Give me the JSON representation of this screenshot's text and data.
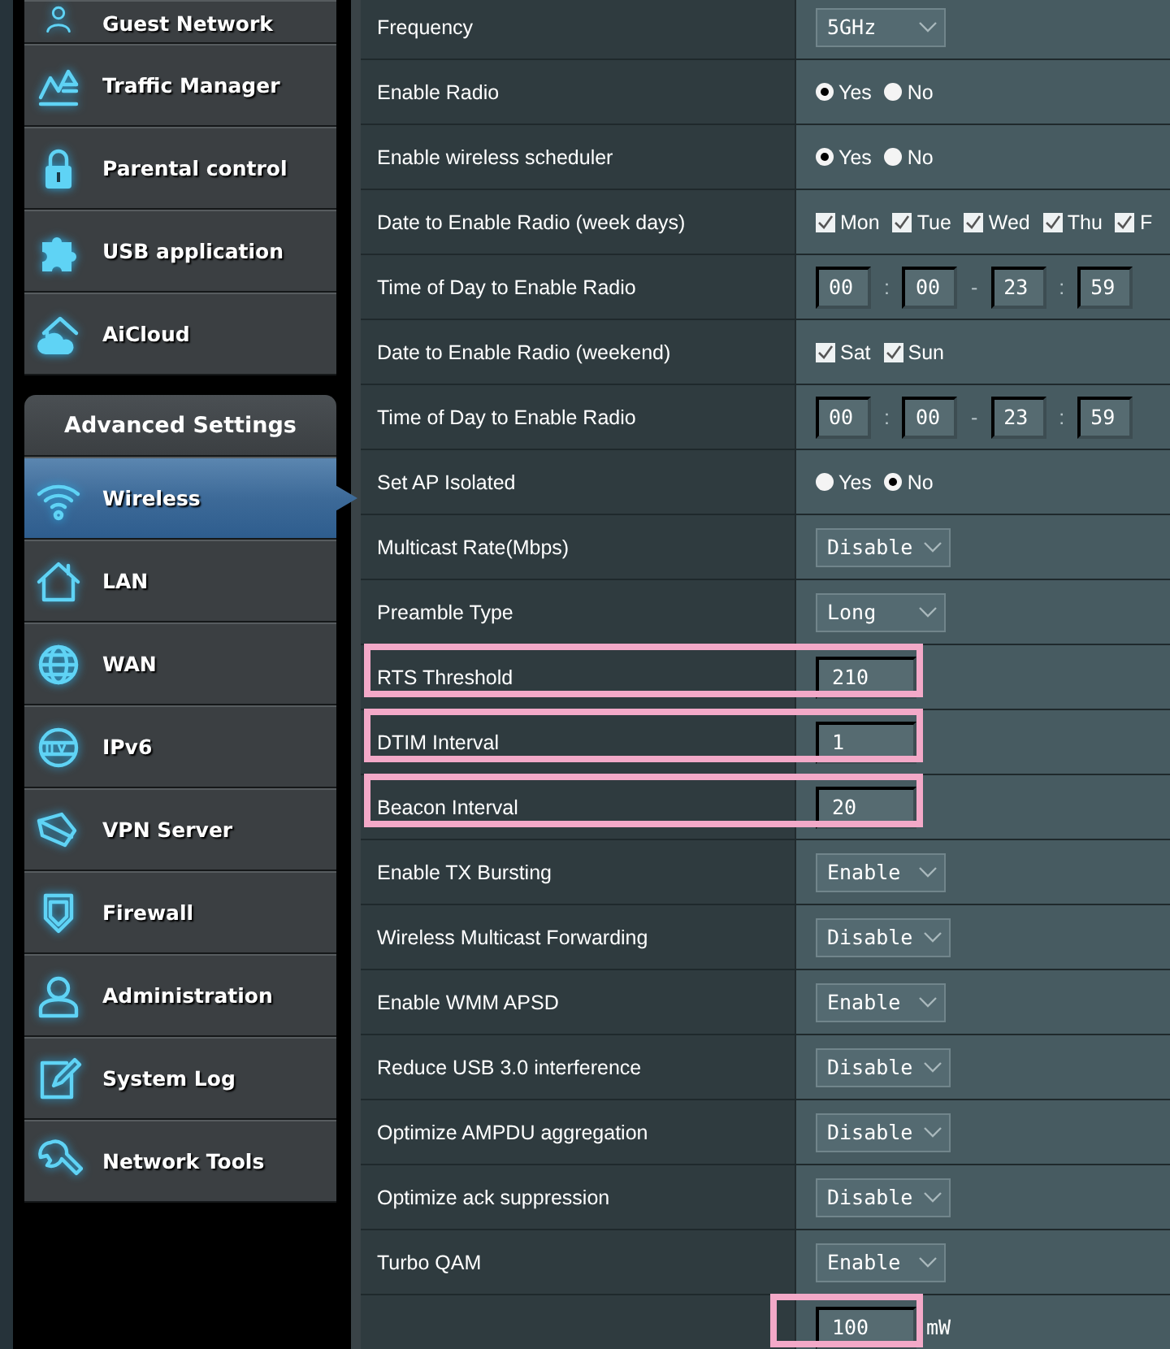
{
  "sidebar": {
    "items": [
      {
        "label": "Guest Network",
        "selected": false
      },
      {
        "label": "Traffic Manager",
        "selected": false
      },
      {
        "label": "Parental control",
        "selected": false
      },
      {
        "label": "USB application",
        "selected": false
      },
      {
        "label": "AiCloud",
        "selected": false
      }
    ],
    "section": {
      "title": "Advanced Settings",
      "items": [
        {
          "label": "Wireless",
          "selected": true
        },
        {
          "label": "LAN",
          "selected": false
        },
        {
          "label": "WAN",
          "selected": false
        },
        {
          "label": "IPv6",
          "selected": false
        },
        {
          "label": "VPN Server",
          "selected": false
        },
        {
          "label": "Firewall",
          "selected": false
        },
        {
          "label": "Administration",
          "selected": false
        },
        {
          "label": "System Log",
          "selected": false
        },
        {
          "label": "Network Tools",
          "selected": false
        }
      ]
    }
  },
  "settings": {
    "rows": [
      {
        "label": "Frequency",
        "kind": "select",
        "value": "5GHz",
        "highlighted": false
      },
      {
        "label": "Enable Radio",
        "kind": "radio",
        "highlighted": false,
        "options": [
          {
            "label": "Yes",
            "selected": true
          },
          {
            "label": "No",
            "selected": false
          }
        ]
      },
      {
        "label": "Enable wireless scheduler",
        "kind": "radio",
        "highlighted": false,
        "options": [
          {
            "label": "Yes",
            "selected": true
          },
          {
            "label": "No",
            "selected": false
          }
        ]
      },
      {
        "label": "Date to Enable Radio (week days)",
        "kind": "checks",
        "highlighted": false,
        "options": [
          {
            "label": "Mon",
            "checked": true
          },
          {
            "label": "Tue",
            "checked": true
          },
          {
            "label": "Wed",
            "checked": true
          },
          {
            "label": "Thu",
            "checked": true
          },
          {
            "label": "F",
            "checked": true
          }
        ]
      },
      {
        "label": "Time of Day to Enable Radio",
        "kind": "time",
        "highlighted": false,
        "fields": [
          "00",
          "00",
          "23",
          "59"
        ],
        "separators": [
          ":",
          "-",
          ":"
        ]
      },
      {
        "label": "Date to Enable Radio (weekend)",
        "kind": "checks",
        "highlighted": false,
        "options": [
          {
            "label": "Sat",
            "checked": true
          },
          {
            "label": "Sun",
            "checked": true
          }
        ]
      },
      {
        "label": "Time of Day to Enable Radio",
        "kind": "time",
        "highlighted": false,
        "fields": [
          "00",
          "00",
          "23",
          "59"
        ],
        "separators": [
          ":",
          "-",
          ":"
        ]
      },
      {
        "label": "Set AP Isolated",
        "kind": "radio",
        "highlighted": false,
        "options": [
          {
            "label": "Yes",
            "selected": false
          },
          {
            "label": "No",
            "selected": true
          }
        ]
      },
      {
        "label": "Multicast Rate(Mbps)",
        "kind": "select",
        "value": "Disable",
        "highlighted": false
      },
      {
        "label": "Preamble Type",
        "kind": "select",
        "value": "Long",
        "highlighted": false
      },
      {
        "label": "RTS Threshold",
        "kind": "text",
        "value": "210",
        "highlighted": true
      },
      {
        "label": "DTIM Interval",
        "kind": "text",
        "value": "1",
        "highlighted": true
      },
      {
        "label": "Beacon Interval",
        "kind": "text",
        "value": "20",
        "highlighted": true
      },
      {
        "label": "Enable TX Bursting",
        "kind": "select",
        "value": "Enable",
        "highlighted": false
      },
      {
        "label": "Wireless Multicast Forwarding",
        "kind": "select",
        "value": "Disable",
        "highlighted": false
      },
      {
        "label": "Enable WMM APSD",
        "kind": "select",
        "value": "Enable",
        "highlighted": false
      },
      {
        "label": "Reduce USB 3.0 interference",
        "kind": "select",
        "value": "Disable",
        "highlighted": false
      },
      {
        "label": "Optimize AMPDU aggregation",
        "kind": "select",
        "value": "Disable",
        "highlighted": false
      },
      {
        "label": "Optimize ack suppression",
        "kind": "select",
        "value": "Disable",
        "highlighted": false
      },
      {
        "label": "Turbo QAM",
        "kind": "select",
        "value": "Enable",
        "highlighted": false
      },
      {
        "kind": "power",
        "value": "100",
        "unit": "mW",
        "highlighted": true
      }
    ]
  }
}
